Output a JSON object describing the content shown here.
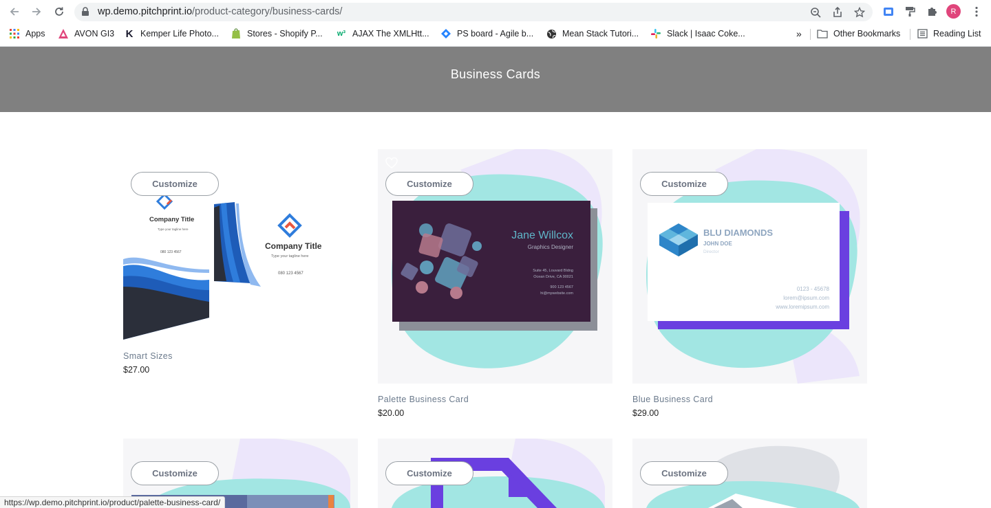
{
  "browser": {
    "url_host": "wp.demo.pitchprint.io",
    "url_path": "/product-category/business-cards/",
    "avatar_letter": "R",
    "bookmarks": [
      {
        "label": "Apps",
        "icon": "apps-grid-icon"
      },
      {
        "label": "AVON GI3",
        "icon": "avon-icon"
      },
      {
        "label": "Kemper Life Photo...",
        "icon": "kemper-icon"
      },
      {
        "label": "Stores - Shopify P...",
        "icon": "shopify-icon"
      },
      {
        "label": "AJAX The XMLHtt...",
        "icon": "w3-icon"
      },
      {
        "label": "PS board - Agile b...",
        "icon": "jira-icon"
      },
      {
        "label": "Mean Stack Tutori...",
        "icon": "globe-icon"
      },
      {
        "label": "Slack | Isaac Coke...",
        "icon": "slack-icon"
      }
    ],
    "overflow_label": "»",
    "other_bookmarks": "Other Bookmarks",
    "reading_list": "Reading List",
    "status_url": "https://wp.demo.pitchprint.io/product/palette-business-card/"
  },
  "page": {
    "title": "Business Cards",
    "customize_label": "Customize"
  },
  "products": [
    {
      "name": "Smart Sizes",
      "price": "$27.00"
    },
    {
      "name": "Palette Business Card",
      "price": "$20.00"
    },
    {
      "name": "Blue Business Card",
      "price": "$29.00"
    },
    {
      "name": "",
      "price": ""
    },
    {
      "name": "",
      "price": ""
    },
    {
      "name": "",
      "price": ""
    }
  ],
  "card_texts": {
    "smart": {
      "company": "Company Title",
      "tagline": "Type your tagline here",
      "phone": "080 123 4567"
    },
    "palette": {
      "name": "Jane Willcox",
      "role": "Graphics Designer",
      "addr1": "Suite 45, Louvard Bldng",
      "addr2": "Ocean Drive, CA 90021",
      "phone": "900 123 4567",
      "web": "hi@mywebsite.com"
    },
    "blue": {
      "company": "BLU DIAMONDS",
      "name": "JOHN DOE",
      "role": "Director",
      "phone": "0123 - 45678",
      "email": "lorem@ipsum.com",
      "web": "www.loremipsum.com"
    }
  },
  "colors": {
    "hero_bg": "#808080",
    "teal_blob": "#a2e6e3",
    "lavender_blob": "#ece6fb",
    "palette_card": "#3a1f3d",
    "purple_accent": "#6a3fe0"
  }
}
